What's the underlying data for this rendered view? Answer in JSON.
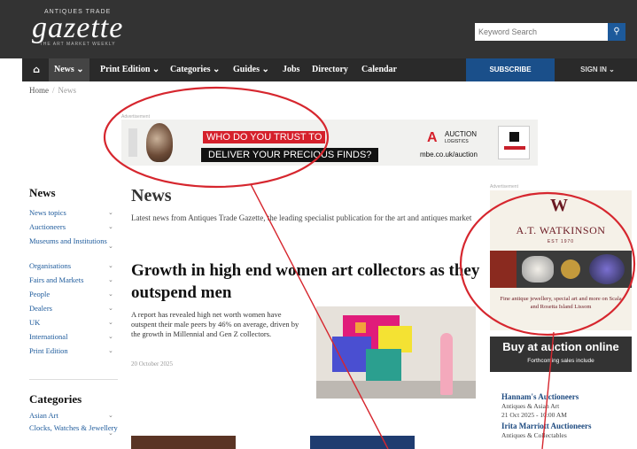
{
  "header": {
    "logo_small": "ANTIQUES TRADE",
    "logo_main": "gazette",
    "logo_sub": "THE ART MARKET WEEKLY",
    "search_placeholder": "Keyword Search",
    "search_icon": "search-icon"
  },
  "nav": {
    "home_icon": "home-icon",
    "items": [
      "News",
      "Print Edition",
      "Categories",
      "Guides",
      "Jobs",
      "Directory",
      "Calendar"
    ],
    "subscribe": "SUBSCRIBE",
    "signin": "SIGN IN"
  },
  "breadcrumb": {
    "home": "Home",
    "current": "News"
  },
  "ads": {
    "label": "Advertisement",
    "banner": {
      "line1": "WHO DO YOU TRUST TO",
      "line2": "DELIVER YOUR PRECIOUS FINDS?",
      "brand_line1": "AUCTION",
      "brand_line2": "LOGISTICS",
      "url": "mbe.co.uk/auction"
    },
    "right": {
      "monogram": "W",
      "name": "A.T. WATKINSON",
      "est": "EST 1970",
      "tagline": "Fine antique jewellery, special art and more on Scala and Rosetta Island Lissom"
    }
  },
  "sidebar": {
    "news_heading": "News",
    "news_items": [
      "News topics",
      "Auctioneers",
      "Museums and Institutions",
      "Organisations",
      "Fairs and Markets",
      "People",
      "Dealers",
      "UK",
      "International",
      "Print Edition"
    ],
    "categories_heading": "Categories",
    "category_items": [
      "Asian Art",
      "Clocks, Watches & Jewellery"
    ]
  },
  "main": {
    "title": "News",
    "intro": "Latest news from Antiques Trade Gazette, the leading specialist publication for the art and antiques market",
    "headline": "Growth in high end women art collectors as they outspend men",
    "teaser": "A report has revealed high net worth women have outspent their male peers by 46% on average, driven by the growth in Millennial and Gen Z collectors.",
    "date": "20 October 2025"
  },
  "auctions": {
    "title": "Buy at auction online",
    "subtitle": "Forthcoming sales include",
    "sales": [
      {
        "name": "Hannam's Auctioneers",
        "category": "Antiques & Asian Art",
        "date": "21 Oct 2025 - 10:00 AM"
      },
      {
        "name": "Irita Marriott Auctioneers",
        "category": "Antiques & Collectables",
        "date": ""
      }
    ]
  },
  "colors": {
    "header_bg": "#333333",
    "nav_bg": "#2a2a2a",
    "subscribe_bg": "#1a4f8a",
    "link_blue": "#1d5a9b",
    "annotation_red": "#d6262e",
    "banner_red": "#d5202b"
  }
}
